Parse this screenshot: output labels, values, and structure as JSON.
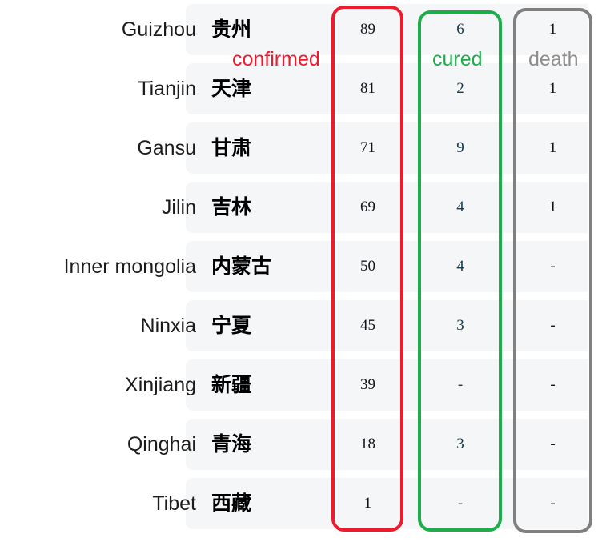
{
  "annotations": {
    "confirmed_label": "confirmed",
    "cured_label": "cured",
    "death_label": "death",
    "confirmed_color": "#ee1b2e",
    "cured_color": "#1fad4b",
    "death_color": "#808080"
  },
  "table": {
    "columns": [
      "name_en",
      "name_zh",
      "confirmed",
      "cured",
      "death"
    ],
    "rows": [
      {
        "name_en": "Guizhou",
        "name_zh": "贵州",
        "confirmed": "89",
        "cured": "6",
        "death": "1"
      },
      {
        "name_en": "Tianjin",
        "name_zh": "天津",
        "confirmed": "81",
        "cured": "2",
        "death": "1"
      },
      {
        "name_en": "Gansu",
        "name_zh": "甘肃",
        "confirmed": "71",
        "cured": "9",
        "death": "1"
      },
      {
        "name_en": "Jilin",
        "name_zh": "吉林",
        "confirmed": "69",
        "cured": "4",
        "death": "1"
      },
      {
        "name_en": "Inner mongolia",
        "name_zh": "内蒙古",
        "confirmed": "50",
        "cured": "4",
        "death": "-"
      },
      {
        "name_en": "Ninxia",
        "name_zh": "宁夏",
        "confirmed": "45",
        "cured": "3",
        "death": "-"
      },
      {
        "name_en": "Xinjiang",
        "name_zh": "新疆",
        "confirmed": "39",
        "cured": "-",
        "death": "-"
      },
      {
        "name_en": "Qinghai",
        "name_zh": "青海",
        "confirmed": "18",
        "cured": "3",
        "death": "-"
      },
      {
        "name_en": "Tibet",
        "name_zh": "西藏",
        "confirmed": "1",
        "cured": "-",
        "death": "-"
      }
    ]
  }
}
